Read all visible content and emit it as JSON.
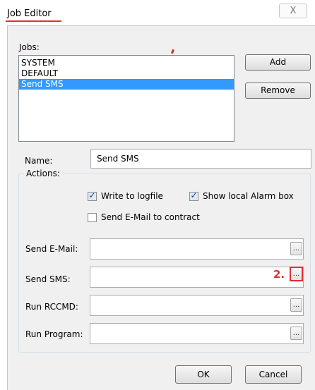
{
  "window": {
    "title": "Job Editor",
    "close_glyph": "X"
  },
  "jobs": {
    "label": "Jobs:",
    "items": [
      "SYSTEM",
      "DEFAULT",
      "Send SMS"
    ],
    "selected_index": 2
  },
  "buttons": {
    "add": "Add",
    "remove": "Remove",
    "ok": "OK",
    "cancel": "Cancel"
  },
  "name": {
    "label": "Name:",
    "value": "Send SMS"
  },
  "actions": {
    "legend": "Actions:",
    "write_logfile": {
      "label": "Write to logfile",
      "checked": true
    },
    "show_alarm": {
      "label": "Show local Alarm box",
      "checked": true
    },
    "send_email_contract": {
      "label": "Send E-Mail to contract",
      "checked": false
    }
  },
  "fields": {
    "send_email": {
      "label": "Send E-Mail:",
      "value": ""
    },
    "send_sms": {
      "label": "Send SMS:",
      "value": ""
    },
    "run_rccmd": {
      "label": "Run RCCMD:",
      "value": ""
    },
    "run_program": {
      "label": "Run Program:",
      "value": ""
    },
    "browse_glyph": "..."
  },
  "annotations": {
    "step": "2.",
    "color": "#e03030"
  },
  "colors": {
    "selection": "#3399ff",
    "dialog_bg": "#f0f0f0"
  },
  "icons": {
    "check": "check-icon",
    "close": "close-icon"
  }
}
